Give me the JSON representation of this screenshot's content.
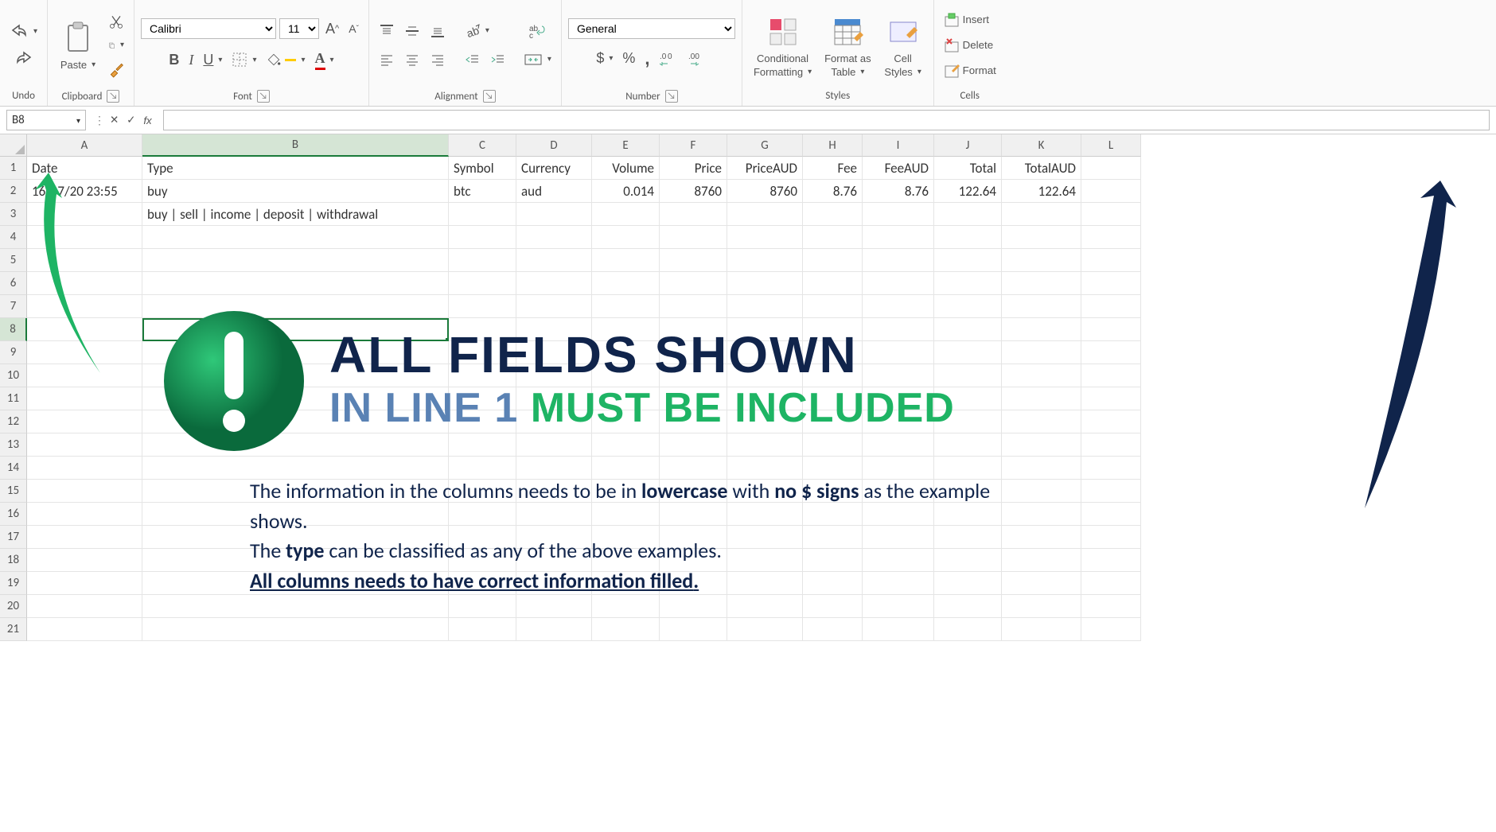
{
  "ribbon": {
    "undo": {
      "label": "Undo"
    },
    "clipboard": {
      "label": "Clipboard",
      "paste": "Paste"
    },
    "font": {
      "label": "Font",
      "family": "Calibri",
      "size": "11",
      "bold": "B",
      "italic": "I",
      "underline": "U"
    },
    "alignment": {
      "label": "Alignment"
    },
    "number": {
      "label": "Number",
      "format": "General",
      "dollar": "$",
      "percent": "%",
      "comma": ","
    },
    "styles": {
      "label": "Styles",
      "conditional": "Conditional",
      "formatting": "Formatting",
      "formatAs": "Format as",
      "table": "Table",
      "cell": "Cell",
      "cellStyles": "Styles"
    },
    "cells": {
      "label": "Cells",
      "insert": "Insert",
      "delete": "Delete",
      "format": "Format"
    }
  },
  "nameBox": "B8",
  "columns": [
    "A",
    "B",
    "C",
    "D",
    "E",
    "F",
    "G",
    "H",
    "I",
    "J",
    "K",
    "L"
  ],
  "colWidths": [
    "wA",
    "wB",
    "wC",
    "wD",
    "wE",
    "wF",
    "wG",
    "wH",
    "wI",
    "wJ",
    "wK",
    "wL"
  ],
  "rows": [
    "1",
    "2",
    "3",
    "4",
    "5",
    "6",
    "7",
    "8",
    "9",
    "10",
    "11",
    "12",
    "13",
    "14",
    "15",
    "16",
    "17",
    "18",
    "19",
    "20",
    "21"
  ],
  "headers": [
    "Date",
    "Type",
    "Symbol",
    "Currency",
    "Volume",
    "Price",
    "PriceAUD",
    "Fee",
    "FeeAUD",
    "Total",
    "TotalAUD"
  ],
  "dataRow": {
    "date": "16/07/20 23:55",
    "type": "buy",
    "symbol": "btc",
    "currency": "aud",
    "volume": "0.014",
    "price": "8760",
    "priceAud": "8760",
    "fee": "8.76",
    "feeAud": "8.76",
    "total": "122.64",
    "totalAud": "122.64"
  },
  "row3B": "buy | sell | income | deposit | withdrawal",
  "annotation": {
    "headline1": "ALL FIELDS SHOWN",
    "headline2a": "IN LINE 1 ",
    "headline2b": "MUST BE INCLUDED",
    "para1a": "The information in the columns needs to be in ",
    "para1b": "lowercase",
    "para1c": " with ",
    "para1d": "no $ signs",
    "para1e": " as the example shows.",
    "para2a": "The ",
    "para2b": "type",
    "para2c": " can be classified as any of the above examples.",
    "para3": "All columns needs to have correct information filled"
  }
}
